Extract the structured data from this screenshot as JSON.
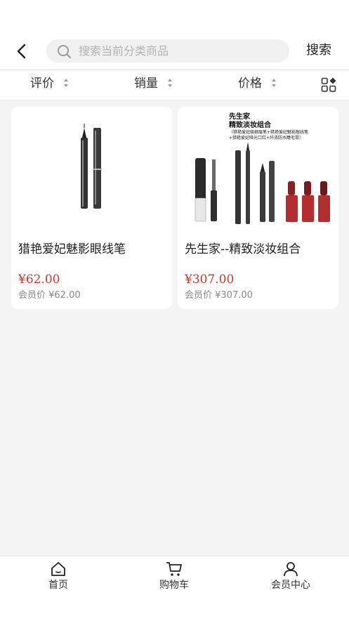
{
  "header": {
    "search_placeholder": "搜索当前分类商品",
    "search_button": "搜索"
  },
  "sort_bar": {
    "items": [
      {
        "label": "评价"
      },
      {
        "label": "销量"
      },
      {
        "label": "价格"
      }
    ],
    "layout_toggle_icon": "grid-layout-icon"
  },
  "products": [
    {
      "title": "猎艳爱妃魅影眼线笔",
      "price": "¥62.00",
      "member_price": "会员价 ¥62.00"
    },
    {
      "title": "先生家--精致淡妆组合",
      "price": "¥307.00",
      "member_price": "会员价 ¥307.00",
      "image_text": {
        "heading_line1": "先生家",
        "heading_line2": "精致淡妆组合",
        "desc_line1": "（猎艳爱妃极细眉笔+猎艳爱妃魅影眼线笔",
        "desc_line2": "+猎艳爱妃哑光口红+纤浓防水睫毛膏）"
      }
    }
  ],
  "tabbar": {
    "items": [
      {
        "label": "首页",
        "icon": "home-icon"
      },
      {
        "label": "购物车",
        "icon": "cart-icon"
      },
      {
        "label": "会员中心",
        "icon": "user-icon"
      }
    ]
  },
  "colors": {
    "price": "#c3392f",
    "background": "#f4f4f4"
  }
}
